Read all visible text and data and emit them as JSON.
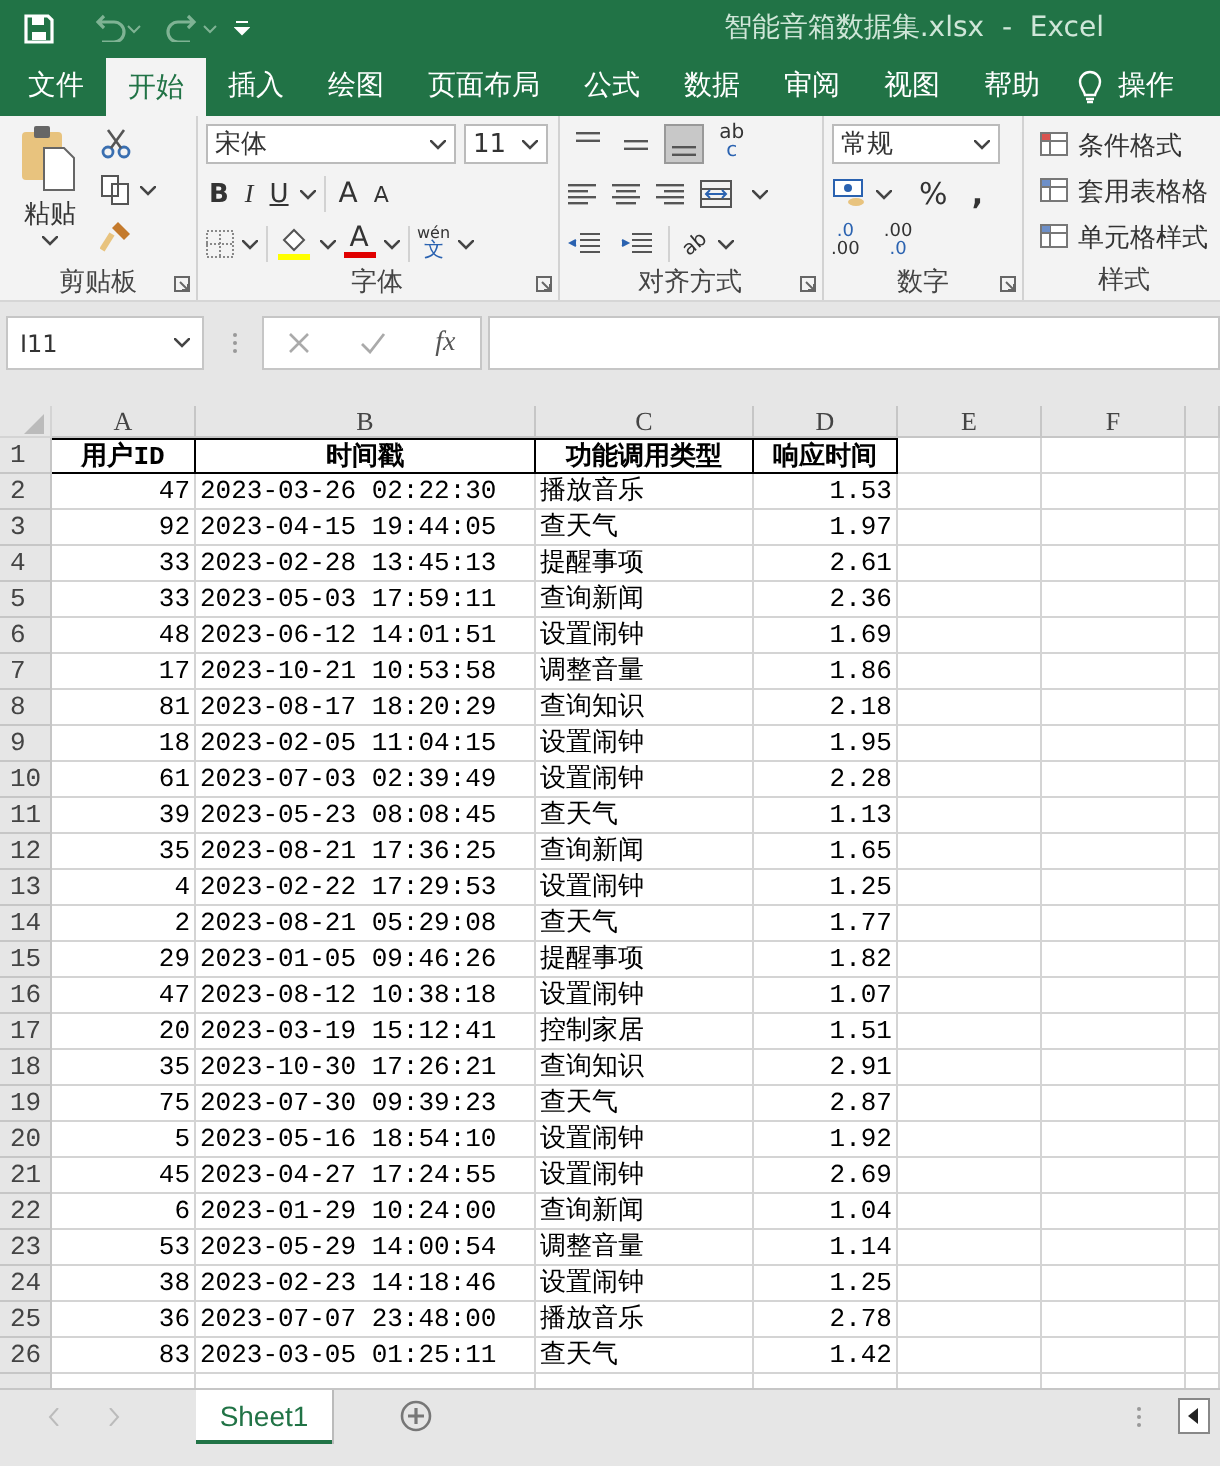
{
  "window": {
    "title": "智能音箱数据集.xlsx  -  Excel"
  },
  "tabs": [
    {
      "label": "文件",
      "selected": false
    },
    {
      "label": "开始",
      "selected": true
    },
    {
      "label": "插入",
      "selected": false
    },
    {
      "label": "绘图",
      "selected": false
    },
    {
      "label": "页面布局",
      "selected": false
    },
    {
      "label": "公式",
      "selected": false
    },
    {
      "label": "数据",
      "selected": false
    },
    {
      "label": "审阅",
      "selected": false
    },
    {
      "label": "视图",
      "selected": false
    },
    {
      "label": "帮助",
      "selected": false
    }
  ],
  "tell_me": "操作",
  "ribbon": {
    "clipboard": {
      "paste": "粘贴",
      "label": "剪贴板"
    },
    "font": {
      "name": "宋体",
      "size": "11",
      "bold": "B",
      "italic": "I",
      "underline": "U",
      "grow": "A",
      "shrink": "A",
      "color_letter": "A",
      "phonetic_top": "wén",
      "phonetic_bottom": "文",
      "label": "字体"
    },
    "alignment": {
      "vertical": [
        {
          "selected": false
        },
        {
          "selected": false
        },
        {
          "selected": true
        }
      ],
      "wrap_top": "ab",
      "wrap_bottom": "c",
      "orientation": "ab",
      "label": "对齐方式"
    },
    "number": {
      "format": "常规",
      "percent": "%",
      "comma": ",",
      "increase_top": ".0",
      "increase_bottom": ".00",
      "decrease_top": ".00",
      "decrease_bottom": ".0",
      "label": "数字"
    },
    "styles": {
      "items": [
        "条件格式",
        "套用表格格",
        "单元格样式"
      ],
      "label": "样式"
    }
  },
  "formula_bar": {
    "name_box": "I11",
    "function": "fx"
  },
  "table": {
    "columns": [
      "A",
      "B",
      "C",
      "D",
      "E",
      "F"
    ],
    "header_row": {
      "number": "1",
      "cells": [
        "用户ID",
        "时间戳",
        "功能调用类型",
        "响应时间"
      ]
    },
    "rows": [
      {
        "number": "2",
        "cells": [
          "47",
          "2023-03-26 02:22:30",
          "播放音乐",
          "1.53"
        ]
      },
      {
        "number": "3",
        "cells": [
          "92",
          "2023-04-15 19:44:05",
          "查天气",
          "1.97"
        ]
      },
      {
        "number": "4",
        "cells": [
          "33",
          "2023-02-28 13:45:13",
          "提醒事项",
          "2.61"
        ]
      },
      {
        "number": "5",
        "cells": [
          "33",
          "2023-05-03 17:59:11",
          "查询新闻",
          "2.36"
        ]
      },
      {
        "number": "6",
        "cells": [
          "48",
          "2023-06-12 14:01:51",
          "设置闹钟",
          "1.69"
        ]
      },
      {
        "number": "7",
        "cells": [
          "17",
          "2023-10-21 10:53:58",
          "调整音量",
          "1.86"
        ]
      },
      {
        "number": "8",
        "cells": [
          "81",
          "2023-08-17 18:20:29",
          "查询知识",
          "2.18"
        ]
      },
      {
        "number": "9",
        "cells": [
          "18",
          "2023-02-05 11:04:15",
          "设置闹钟",
          "1.95"
        ]
      },
      {
        "number": "10",
        "cells": [
          "61",
          "2023-07-03 02:39:49",
          "设置闹钟",
          "2.28"
        ]
      },
      {
        "number": "11",
        "cells": [
          "39",
          "2023-05-23 08:08:45",
          "查天气",
          "1.13"
        ]
      },
      {
        "number": "12",
        "cells": [
          "35",
          "2023-08-21 17:36:25",
          "查询新闻",
          "1.65"
        ]
      },
      {
        "number": "13",
        "cells": [
          "4",
          "2023-02-22 17:29:53",
          "设置闹钟",
          "1.25"
        ]
      },
      {
        "number": "14",
        "cells": [
          "2",
          "2023-08-21 05:29:08",
          "查天气",
          "1.77"
        ]
      },
      {
        "number": "15",
        "cells": [
          "29",
          "2023-01-05 09:46:26",
          "提醒事项",
          "1.82"
        ]
      },
      {
        "number": "16",
        "cells": [
          "47",
          "2023-08-12 10:38:18",
          "设置闹钟",
          "1.07"
        ]
      },
      {
        "number": "17",
        "cells": [
          "20",
          "2023-03-19 15:12:41",
          "控制家居",
          "1.51"
        ]
      },
      {
        "number": "18",
        "cells": [
          "35",
          "2023-10-30 17:26:21",
          "查询知识",
          "2.91"
        ]
      },
      {
        "number": "19",
        "cells": [
          "75",
          "2023-07-30 09:39:23",
          "查天气",
          "2.87"
        ]
      },
      {
        "number": "20",
        "cells": [
          "5",
          "2023-05-16 18:54:10",
          "设置闹钟",
          "1.92"
        ]
      },
      {
        "number": "21",
        "cells": [
          "45",
          "2023-04-27 17:24:55",
          "设置闹钟",
          "2.69"
        ]
      },
      {
        "number": "22",
        "cells": [
          "6",
          "2023-01-29 10:24:00",
          "查询新闻",
          "1.04"
        ]
      },
      {
        "number": "23",
        "cells": [
          "53",
          "2023-05-29 14:00:54",
          "调整音量",
          "1.14"
        ]
      },
      {
        "number": "24",
        "cells": [
          "38",
          "2023-02-23 14:18:46",
          "设置闹钟",
          "1.25"
        ]
      },
      {
        "number": "25",
        "cells": [
          "36",
          "2023-07-07 23:48:00",
          "播放音乐",
          "2.78"
        ]
      },
      {
        "number": "26",
        "cells": [
          "83",
          "2023-03-05 01:25:11",
          "查天气",
          "1.42"
        ]
      }
    ]
  },
  "sheets": [
    {
      "label": "Sheet1",
      "selected": true
    }
  ]
}
